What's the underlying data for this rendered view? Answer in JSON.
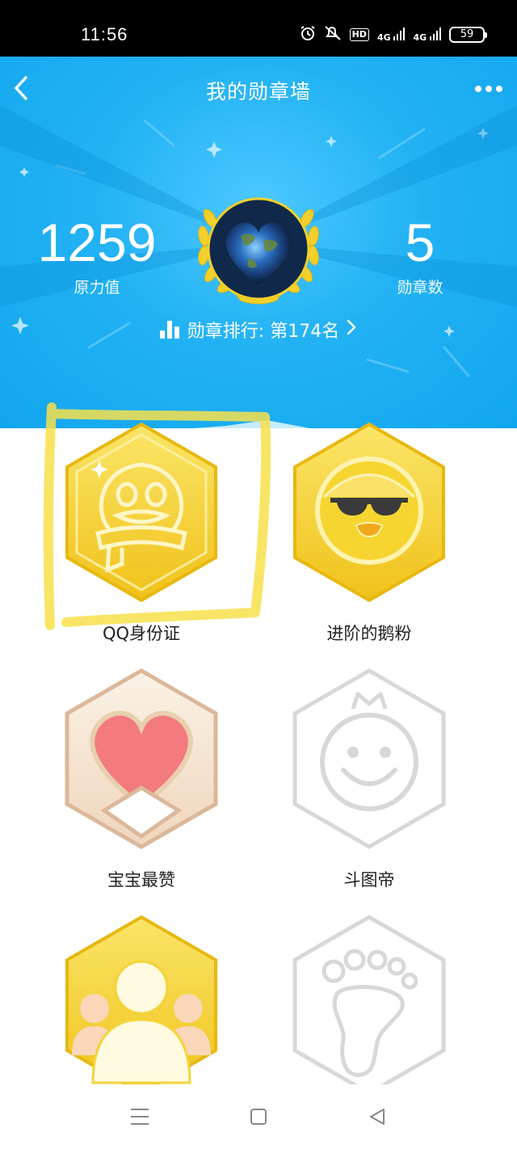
{
  "status_bar": {
    "time": "11:56",
    "hd_label": "HD",
    "net1": "4G",
    "net2": "4G",
    "battery": "59"
  },
  "header": {
    "title": "我的勋章墙",
    "force_value": "1259",
    "force_label": "原力值",
    "badge_count": "5",
    "badge_count_label": "勋章数",
    "rank_text": "勋章排行: 第174名"
  },
  "badges": [
    {
      "name": "QQ身份证",
      "state": "earned",
      "color": "gold"
    },
    {
      "name": "进阶的鹅粉",
      "state": "earned",
      "color": "gold"
    },
    {
      "name": "宝宝最赞",
      "state": "earned",
      "color": "pink"
    },
    {
      "name": "斗图帝",
      "state": "locked",
      "color": "gray"
    },
    {
      "name": "",
      "state": "earned",
      "color": "gold"
    },
    {
      "name": "",
      "state": "locked",
      "color": "gray"
    }
  ],
  "colors": {
    "header_blue": "#1aaaf0",
    "gold": "#f5d33a",
    "locked_gray": "#d8d8d8",
    "highlight_yellow": "#f7e04a"
  }
}
